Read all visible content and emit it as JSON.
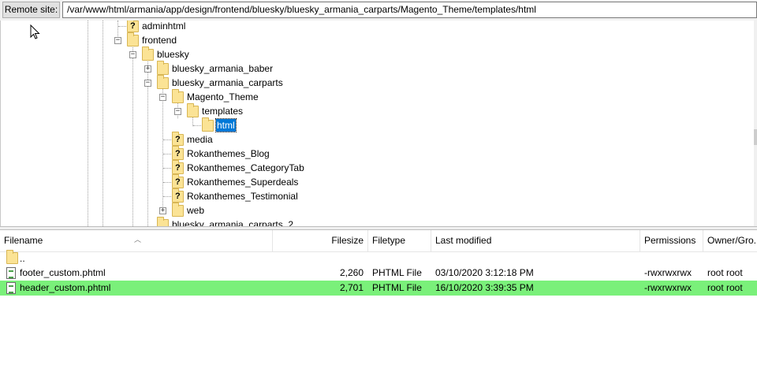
{
  "remote_site": {
    "label": "Remote site:",
    "path": "/var/www/html/armania/app/design/frontend/bluesky/bluesky_armania_carparts/Magento_Theme/templates/html"
  },
  "tree": {
    "nodes": [
      {
        "label": "adminhtml",
        "icon": "unknown-folder-icon"
      },
      {
        "label": "frontend",
        "icon": "folder-icon",
        "expander": "−"
      },
      {
        "label": "bluesky",
        "icon": "folder-icon",
        "expander": "−"
      },
      {
        "label": "bluesky_armania_baber",
        "icon": "folder-icon",
        "expander": "+"
      },
      {
        "label": "bluesky_armania_carparts",
        "icon": "folder-icon",
        "expander": "−"
      },
      {
        "label": "Magento_Theme",
        "icon": "folder-icon",
        "expander": "−"
      },
      {
        "label": "templates",
        "icon": "folder-icon",
        "expander": "−"
      },
      {
        "label": "html",
        "icon": "folder-icon",
        "selected": true
      },
      {
        "label": "media",
        "icon": "unknown-folder-icon"
      },
      {
        "label": "Rokanthemes_Blog",
        "icon": "unknown-folder-icon"
      },
      {
        "label": "Rokanthemes_CategoryTab",
        "icon": "unknown-folder-icon"
      },
      {
        "label": "Rokanthemes_Superdeals",
        "icon": "unknown-folder-icon"
      },
      {
        "label": "Rokanthemes_Testimonial",
        "icon": "unknown-folder-icon"
      },
      {
        "label": "web",
        "icon": "folder-icon",
        "expander": "+"
      },
      {
        "label": "bluesky_armania_carparts_2",
        "icon": "folder-icon"
      }
    ]
  },
  "file_list": {
    "columns": {
      "filename": "Filename",
      "filesize": "Filesize",
      "filetype": "Filetype",
      "last_modified": "Last modified",
      "permissions": "Permissions",
      "owner_group": "Owner/Gro..."
    },
    "rows": [
      {
        "filename": "..",
        "filesize": "",
        "filetype": "",
        "last_modified": "",
        "permissions": "",
        "owner_group": "",
        "icon": "folder-icon"
      },
      {
        "filename": "footer_custom.phtml",
        "filesize": "2,260",
        "filetype": "PHTML File",
        "last_modified": "03/10/2020 3:12:18 PM",
        "permissions": "-rwxrwxrwx",
        "owner_group": "root root",
        "icon": "file-icon"
      },
      {
        "filename": "header_custom.phtml",
        "filesize": "2,701",
        "filetype": "PHTML File",
        "last_modified": "16/10/2020 3:39:35 PM",
        "permissions": "-rwxrwxrwx",
        "owner_group": "root root",
        "icon": "file-icon",
        "selected": true
      }
    ],
    "highlight_color": "#7af07a"
  },
  "colors": {
    "selection_blue": "#0078d7",
    "folder_yellow": "#fbe395"
  }
}
